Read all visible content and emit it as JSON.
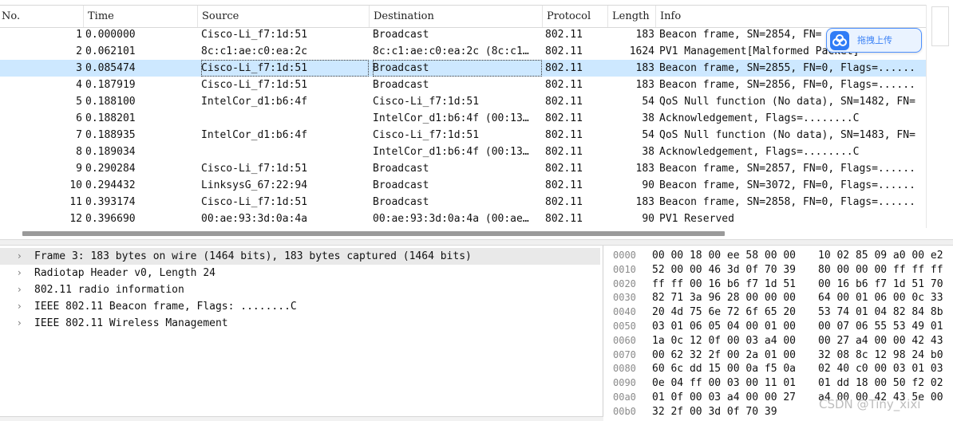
{
  "packet_list": {
    "columns": [
      "No.",
      "Time",
      "Source",
      "Destination",
      "Protocol",
      "Length",
      "Info"
    ],
    "selected_index": 2,
    "rows": [
      {
        "no": "1",
        "time": "0.000000",
        "src": "Cisco-Li_f7:1d:51",
        "dst": "Broadcast",
        "proto": "802.11",
        "len": "183",
        "info": "Beacon frame, SN=2854, FN="
      },
      {
        "no": "2",
        "time": "0.062101",
        "src": "8c:c1:ae:c0:ea:2c",
        "dst": "8c:c1:ae:c0:ea:2c (8c:c1…",
        "proto": "802.11",
        "len": "1624",
        "info": "PV1 Management[Malformed Packet]"
      },
      {
        "no": "3",
        "time": "0.085474",
        "src": "Cisco-Li_f7:1d:51",
        "dst": "Broadcast",
        "proto": "802.11",
        "len": "183",
        "info": "Beacon frame, SN=2855, FN=0, Flags=......"
      },
      {
        "no": "4",
        "time": "0.187919",
        "src": "Cisco-Li_f7:1d:51",
        "dst": "Broadcast",
        "proto": "802.11",
        "len": "183",
        "info": "Beacon frame, SN=2856, FN=0, Flags=......"
      },
      {
        "no": "5",
        "time": "0.188100",
        "src": "IntelCor_d1:b6:4f",
        "dst": "Cisco-Li_f7:1d:51",
        "proto": "802.11",
        "len": "54",
        "info": "QoS Null function (No data), SN=1482, FN="
      },
      {
        "no": "6",
        "time": "0.188201",
        "src": "",
        "dst": "IntelCor_d1:b6:4f (00:13…",
        "proto": "802.11",
        "len": "38",
        "info": "Acknowledgement, Flags=........C"
      },
      {
        "no": "7",
        "time": "0.188935",
        "src": "IntelCor_d1:b6:4f",
        "dst": "Cisco-Li_f7:1d:51",
        "proto": "802.11",
        "len": "54",
        "info": "QoS Null function (No data), SN=1483, FN="
      },
      {
        "no": "8",
        "time": "0.189034",
        "src": "",
        "dst": "IntelCor_d1:b6:4f (00:13…",
        "proto": "802.11",
        "len": "38",
        "info": "Acknowledgement, Flags=........C"
      },
      {
        "no": "9",
        "time": "0.290284",
        "src": "Cisco-Li_f7:1d:51",
        "dst": "Broadcast",
        "proto": "802.11",
        "len": "183",
        "info": "Beacon frame, SN=2857, FN=0, Flags=......"
      },
      {
        "no": "10",
        "time": "0.294432",
        "src": "LinksysG_67:22:94",
        "dst": "Broadcast",
        "proto": "802.11",
        "len": "90",
        "info": "Beacon frame, SN=3072, FN=0, Flags=......"
      },
      {
        "no": "11",
        "time": "0.393174",
        "src": "Cisco-Li_f7:1d:51",
        "dst": "Broadcast",
        "proto": "802.11",
        "len": "183",
        "info": "Beacon frame, SN=2858, FN=0, Flags=......"
      },
      {
        "no": "12",
        "time": "0.396690",
        "src": "00:ae:93:3d:0a:4a",
        "dst": "00:ae:93:3d:0a:4a (00:ae…",
        "proto": "802.11",
        "len": "90",
        "info": "PV1 Reserved"
      }
    ]
  },
  "upload_button": {
    "label": "拖拽上传",
    "icon": "cloud-upload-icon"
  },
  "details": {
    "expander_icon": "chevron-right-icon",
    "nodes": [
      "Frame 3: 183 bytes on wire (1464 bits), 183 bytes captured (1464 bits)",
      "Radiotap Header v0, Length 24",
      "802.11 radio information",
      "IEEE 802.11 Beacon frame, Flags: ........C",
      "IEEE 802.11 Wireless Management"
    ]
  },
  "hex_dump": [
    {
      "offset": "0000",
      "b1": "00 00 18 00 ee 58 00 00",
      "b2": "10 02 85 09 a0 00 e2"
    },
    {
      "offset": "0010",
      "b1": "52 00 00 46 3d 0f 70 39",
      "b2": "80 00 00 00 ff ff ff"
    },
    {
      "offset": "0020",
      "b1": "ff ff 00 16 b6 f7 1d 51",
      "b2": "00 16 b6 f7 1d 51 70"
    },
    {
      "offset": "0030",
      "b1": "82 71 3a 96 28 00 00 00",
      "b2": "64 00 01 06 00 0c 33"
    },
    {
      "offset": "0040",
      "b1": "20 4d 75 6e 72 6f 65 20",
      "b2": "53 74 01 04 82 84 8b"
    },
    {
      "offset": "0050",
      "b1": "03 01 06 05 04 00 01 00",
      "b2": "00 07 06 55 53 49 01"
    },
    {
      "offset": "0060",
      "b1": "1a 0c 12 0f 00 03 a4 00",
      "b2": "00 27 a4 00 00 42 43"
    },
    {
      "offset": "0070",
      "b1": "00 62 32 2f 00 2a 01 00",
      "b2": "32 08 8c 12 98 24 b0"
    },
    {
      "offset": "0080",
      "b1": "60 6c dd 15 00 0a f5 0a",
      "b2": "02 40 c0 00 03 01 03"
    },
    {
      "offset": "0090",
      "b1": "0e 04 ff 00 03 00 11 01",
      "b2": "01 dd 18 00 50 f2 02"
    },
    {
      "offset": "00a0",
      "b1": "01 0f 00 03 a4 00 00 27",
      "b2": "a4 00 00 42 43 5e 00"
    },
    {
      "offset": "00b0",
      "b1": "32 2f 00 3d 0f 70 39",
      "b2": ""
    }
  ],
  "watermark": "CSDN @Tiny_xixi"
}
